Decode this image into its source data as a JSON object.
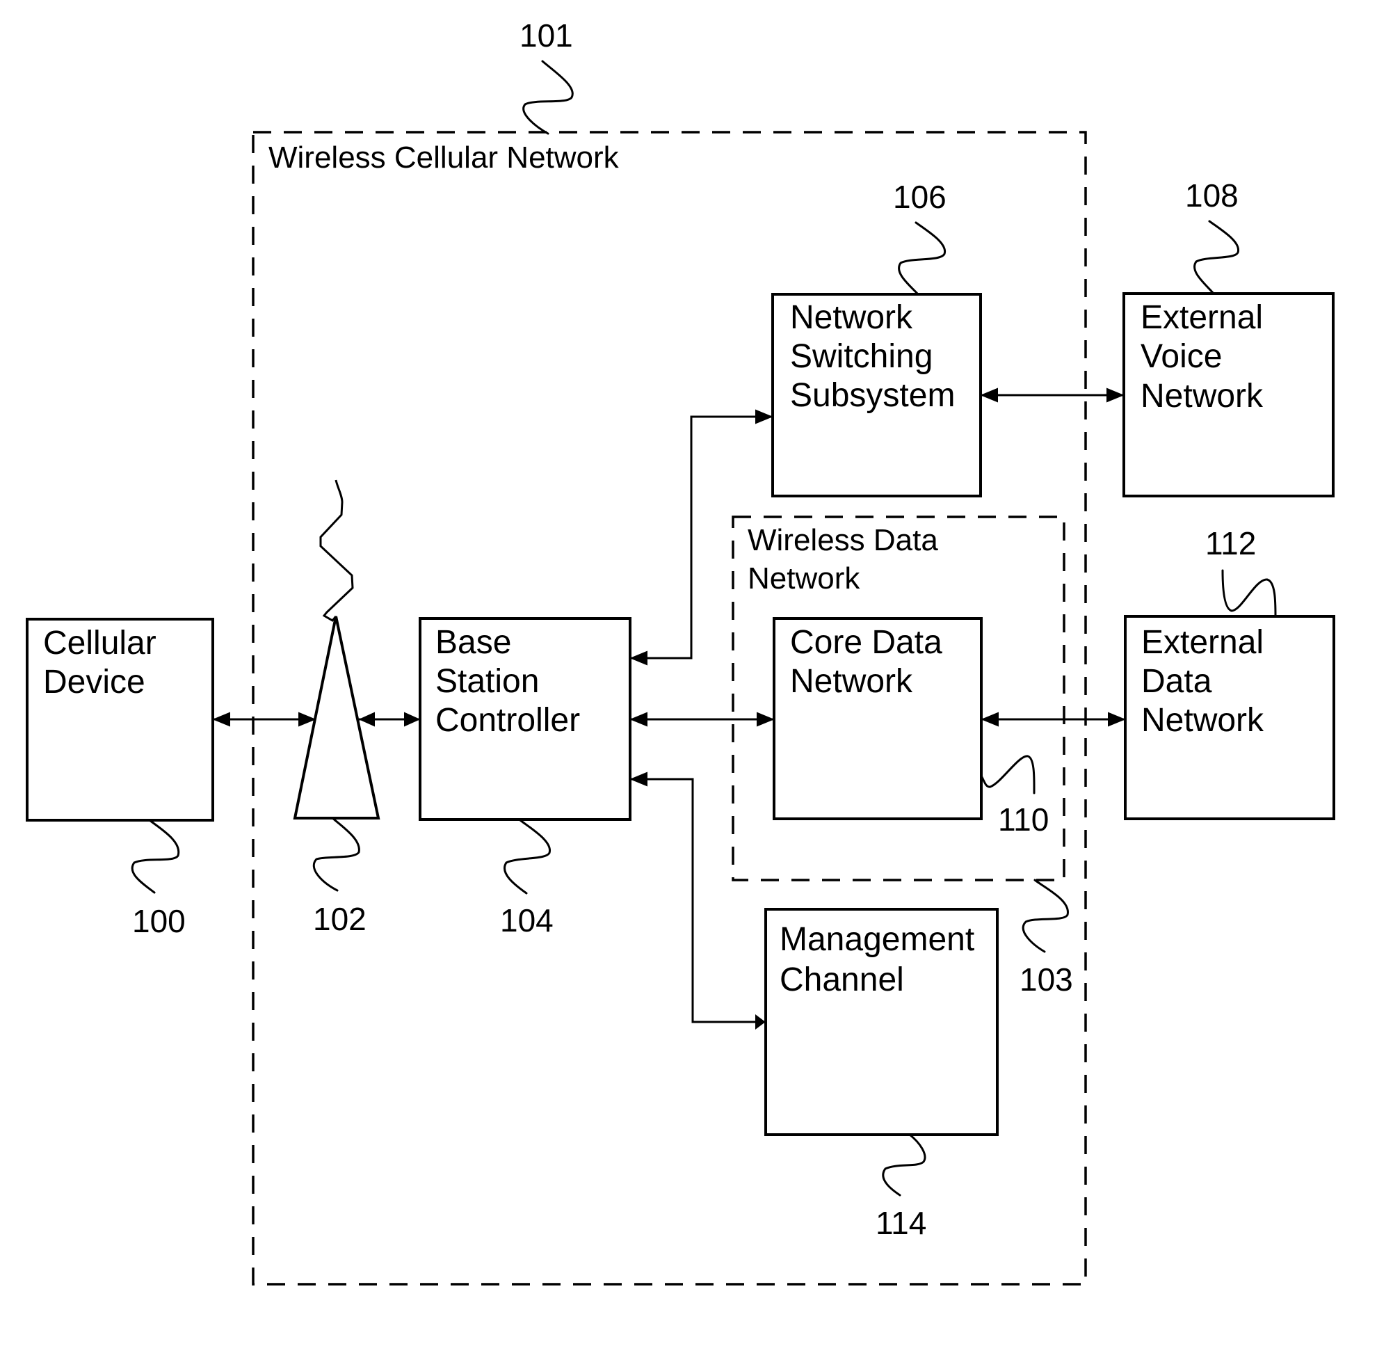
{
  "figure": {
    "groups": {
      "wireless_cellular_network": {
        "label": "Wireless Cellular Network",
        "ref": "101"
      },
      "wireless_data_network": {
        "label_lines": [
          "Wireless Data",
          "Network"
        ],
        "ref": "103"
      }
    },
    "blocks": {
      "cellular_device": {
        "lines": [
          "Cellular",
          "Device"
        ],
        "ref": "100"
      },
      "antenna": {
        "ref": "102"
      },
      "base_station_controller": {
        "lines": [
          "Base",
          "Station",
          "Controller"
        ],
        "ref": "104"
      },
      "network_switching_subsystem": {
        "lines": [
          "Network",
          "Switching",
          "Subsystem"
        ],
        "ref": "106"
      },
      "external_voice_network": {
        "lines": [
          "External",
          "Voice",
          "Network"
        ],
        "ref": "108"
      },
      "core_data_network": {
        "lines": [
          "Core Data",
          "Network"
        ],
        "ref": "110"
      },
      "external_data_network": {
        "lines": [
          "External",
          "Data",
          "Network"
        ],
        "ref": "112"
      },
      "management_channel": {
        "lines": [
          "Management",
          "Channel"
        ],
        "ref": "114"
      }
    },
    "connections": [
      {
        "from": "Cellular Device",
        "to": "Antenna",
        "type": "bidirectional"
      },
      {
        "from": "Antenna",
        "to": "Base Station Controller",
        "type": "bidirectional"
      },
      {
        "from": "Base Station Controller",
        "to": "Network Switching Subsystem",
        "type": "bidirectional"
      },
      {
        "from": "Base Station Controller",
        "to": "Core Data Network",
        "type": "bidirectional"
      },
      {
        "from": "Base Station Controller",
        "to": "Management Channel",
        "type": "bidirectional"
      },
      {
        "from": "Network Switching Subsystem",
        "to": "External Voice Network",
        "type": "bidirectional"
      },
      {
        "from": "Core Data Network",
        "to": "External Data Network",
        "type": "bidirectional"
      }
    ]
  }
}
